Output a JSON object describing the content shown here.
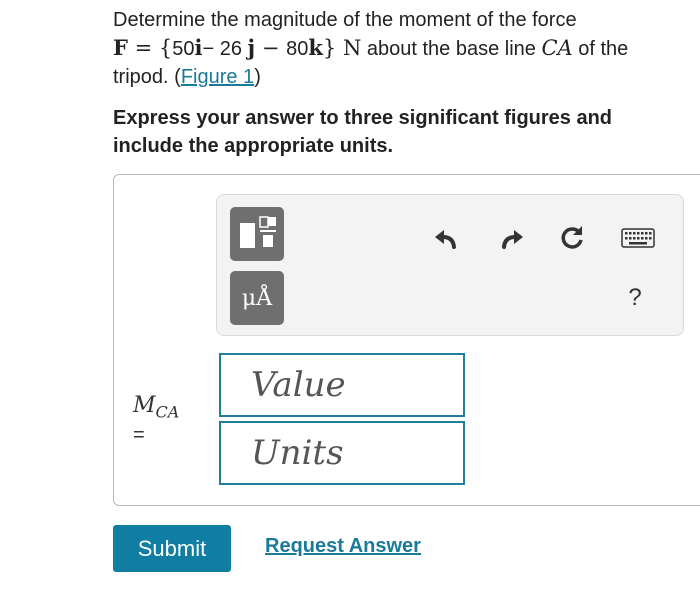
{
  "problem": {
    "line1": "Determine the magnitude of the moment of the force",
    "force_symbol": "F",
    "eq": " = {",
    "c1": "50",
    "u1": "i",
    "minus1": "− ",
    "c2": "26",
    "u2": "j",
    "minus2": " − ",
    "c3": "80",
    "u3": "k",
    "close": "} N",
    "about": " about the base line ",
    "line_ref": "CA",
    "of_the": " of the",
    "line3_prefix": "tripod. (",
    "figure_link": "Figure 1",
    "line3_suffix": ")"
  },
  "instructions": "Express your answer to three significant figures and include the appropriate units.",
  "toolbar": {
    "units_button_label": "μÅ",
    "help_label": "?"
  },
  "answer": {
    "variable": "M",
    "subscript": "CA",
    "equals": "=",
    "value_placeholder": "Value",
    "units_placeholder": "Units"
  },
  "actions": {
    "submit_label": "Submit",
    "request_label": "Request Answer"
  },
  "colors": {
    "accent": "#0f7ea2",
    "link": "#1a7a9a",
    "toolbar_button": "#6f6f6f"
  }
}
